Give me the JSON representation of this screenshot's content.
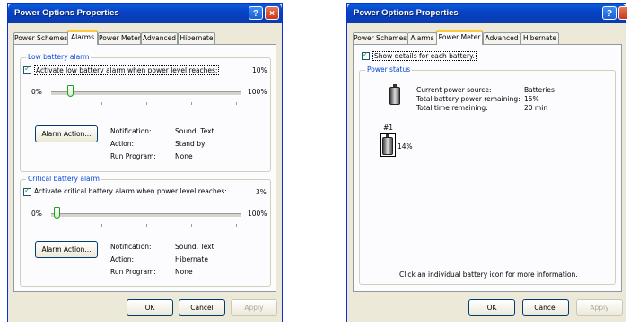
{
  "left": {
    "title": "Power Options Properties",
    "help": "?",
    "close": "×",
    "tabs": [
      "Power Schemes",
      "Alarms",
      "Power Meter",
      "Advanced",
      "Hibernate"
    ],
    "active_tab": "Alarms",
    "low": {
      "group": "Low battery alarm",
      "check_label": "Activate low battery alarm when power level reaches:",
      "checked": true,
      "value": "10%",
      "min": "0%",
      "max": "100%",
      "slider_level": 0.1,
      "action_button": "Alarm Action...",
      "notification_label": "Notification:",
      "notification_value": "Sound, Text",
      "action_label": "Action:",
      "action_value": "Stand by",
      "program_label": "Run Program:",
      "program_value": "None"
    },
    "critical": {
      "group": "Critical battery alarm",
      "check_label": "Activate critical battery alarm when power level reaches:",
      "checked": true,
      "value": "3%",
      "min": "0%",
      "max": "100%",
      "slider_level": 0.03,
      "action_button": "Alarm Action...",
      "notification_label": "Notification:",
      "notification_value": "Sound, Text",
      "action_label": "Action:",
      "action_value": "Hibernate",
      "program_label": "Run Program:",
      "program_value": "None"
    },
    "ok": "OK",
    "cancel": "Cancel",
    "apply": "Apply"
  },
  "right": {
    "title": "Power Options Properties",
    "help": "?",
    "tabs": [
      "Power Schemes",
      "Alarms",
      "Power Meter",
      "Advanced",
      "Hibernate"
    ],
    "active_tab": "Power Meter",
    "show_details": "Show details for each battery.",
    "show_details_checked": true,
    "group": "Power status",
    "source_label": "Current power source:",
    "source_value": "Batteries",
    "remaining_label": "Total battery power remaining:",
    "remaining_value": "15%",
    "time_label": "Total time remaining:",
    "time_value": "20 min",
    "battery_id": "#1",
    "battery_percent": "14%",
    "info": "Click an individual battery icon for more information.",
    "ok": "OK",
    "cancel": "Cancel",
    "apply": "Apply"
  }
}
